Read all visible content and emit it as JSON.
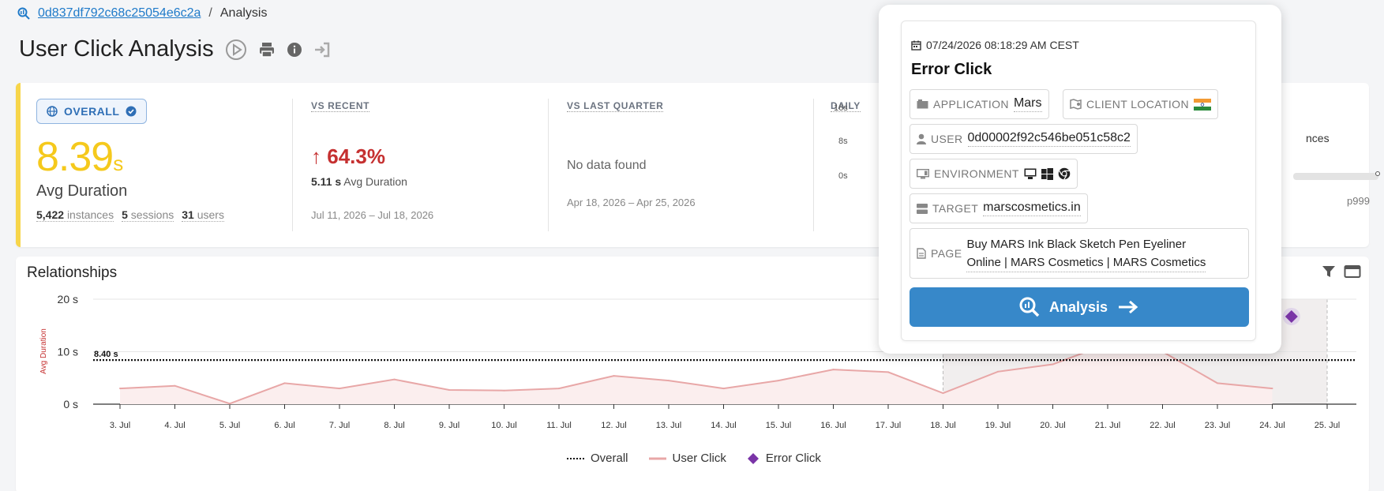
{
  "breadcrumb": {
    "id": "0d837df792c68c25054e6c2a",
    "separator": "/",
    "current": "Analysis"
  },
  "title": {
    "part1": "User Click",
    "part2": "Analysis"
  },
  "overall": {
    "badge": "OVERALL",
    "value": "8.39",
    "unit": "s",
    "label": "Avg Duration",
    "instances_n": "5,422",
    "instances_l": "instances",
    "sessions_n": "5",
    "sessions_l": "sessions",
    "users_n": "31",
    "users_l": "users"
  },
  "vs_recent": {
    "head": "VS RECENT",
    "arrow": "↑",
    "pct": "64.3%",
    "sub_val": "5.11 s",
    "sub_lbl": "Avg Duration",
    "range": "Jul 11, 2026 – Jul 18, 2026"
  },
  "vs_quarter": {
    "head": "VS LAST QUARTER",
    "nodata": "No data found",
    "range": "Apr 18, 2026 – Apr 25, 2026"
  },
  "daily": {
    "head": "DAILY",
    "ticks": [
      "16s",
      "8s",
      "0s"
    ],
    "right_text": "nces",
    "p999": "p999"
  },
  "relationships": {
    "title": "Relationships"
  },
  "chart_data": {
    "type": "line",
    "ylabel": "Avg Duration",
    "y_ticks": [
      "20 s",
      "10 s",
      "0 s"
    ],
    "ylim": [
      0,
      20
    ],
    "categories": [
      "3. Jul",
      "4. Jul",
      "5. Jul",
      "6. Jul",
      "7. Jul",
      "8. Jul",
      "9. Jul",
      "10. Jul",
      "11. Jul",
      "12. Jul",
      "13. Jul",
      "14. Jul",
      "15. Jul",
      "16. Jul",
      "17. Jul",
      "18. Jul",
      "19. Jul",
      "20. Jul",
      "21. Jul",
      "22. Jul",
      "23. Jul",
      "24. Jul",
      "25. Jul"
    ],
    "series": [
      {
        "name": "User Click",
        "values": [
          3.0,
          3.5,
          0.1,
          4.0,
          3.0,
          4.7,
          2.7,
          2.6,
          3.0,
          5.4,
          4.5,
          3.0,
          4.5,
          6.6,
          6.1,
          2.1,
          6.2,
          7.6,
          11.5,
          10.0,
          4.0,
          3.0,
          null
        ]
      },
      {
        "name": "Overall",
        "constant": 8.4,
        "label": "8.40 s"
      },
      {
        "name": "Error Click",
        "points": [
          {
            "x": "24. Jul",
            "offset": 0.35,
            "y": 16.7
          }
        ]
      }
    ],
    "highlight_range": [
      "18. Jul",
      "25. Jul"
    ],
    "grid": true,
    "legend": "bottom"
  },
  "legend": {
    "overall": "Overall",
    "user_click": "User Click",
    "error_click": "Error Click"
  },
  "popup": {
    "datetime": "07/24/2026 08:18:29 AM CEST",
    "title": "Error Click",
    "application_lbl": "APPLICATION",
    "application_val": "Mars",
    "location_lbl": "CLIENT LOCATION",
    "user_lbl": "USER",
    "user_val": "0d00002f92c546be051c58c2",
    "env_lbl": "ENVIRONMENT",
    "target_lbl": "TARGET",
    "target_val": "marscosmetics.in",
    "page_lbl": "PAGE",
    "page_line1": "Buy MARS Ink Black Sketch Pen Eyeliner",
    "page_line2": "Online | MARS Cosmetics | MARS Cosmetics",
    "button": "Analysis"
  },
  "colors": {
    "accent": "#3788c9",
    "user_click": "#e8a7a7",
    "error_click": "#7a34a7",
    "gold": "#f5c91c",
    "red": "#c53030"
  }
}
